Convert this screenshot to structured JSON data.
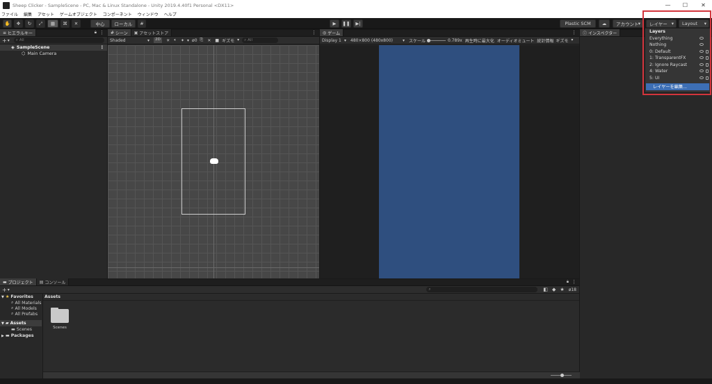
{
  "window": {
    "title": "Sheep Clicker - SampleScene - PC, Mac & Linux Standalone - Unity 2019.4.40f1 Personal <DX11>",
    "controls": [
      "—",
      "☐",
      "✕"
    ]
  },
  "menu": [
    "ファイル",
    "編集",
    "アセット",
    "ゲームオブジェクト",
    "コンポーネント",
    "ウィンドウ",
    "ヘルプ"
  ],
  "toolbar": {
    "pivot_center": "中心",
    "pivot_local": "ローカル",
    "plastic_scm": "Plastic SCM",
    "account": "アカウント",
    "layers": "レイヤー",
    "layout": "Layout"
  },
  "hierarchy": {
    "tab": "ヒエラルキー",
    "search_placeholder": "All",
    "scene": "SampleScene",
    "objects": [
      "Main Camera"
    ]
  },
  "scene": {
    "tab": "シーン",
    "tab2": "アセットストア",
    "shading": "Shaded",
    "mode_2d": "2D",
    "hidden_count": "0",
    "gizmos": "ギズモ",
    "search_placeholder": "All"
  },
  "game": {
    "tab": "ゲーム",
    "display": "Display 1",
    "resolution": "480×800 (480x800)",
    "scale_label": "スケール",
    "scale_value": "0.789x",
    "maximize": "再生時に最大化",
    "mute": "オーディオミュート",
    "stats": "統計情報",
    "gizmos": "ギズモ",
    "background_color": "#2f4f7f"
  },
  "inspector": {
    "tab": "インスペクター"
  },
  "layers_menu": {
    "header": "Layers",
    "items": [
      "Everything",
      "Nothing",
      "0: Default",
      "1: TransparentFX",
      "2: Ignore Raycast",
      "4: Water",
      "5: UI"
    ],
    "edit": "レイヤーを編集..."
  },
  "project": {
    "tab": "プロジェクト",
    "tab2": "コンソール",
    "favorites": "Favorites",
    "favorites_items": [
      "All Materials",
      "All Models",
      "All Prefabs"
    ],
    "assets": "Assets",
    "assets_children": [
      "Scenes"
    ],
    "packages": "Packages",
    "breadcrumb": "Assets",
    "folder": "Scenes",
    "count": "18"
  },
  "colors": {
    "accent": "#3d6fb5",
    "highlight": "#d3343c"
  }
}
